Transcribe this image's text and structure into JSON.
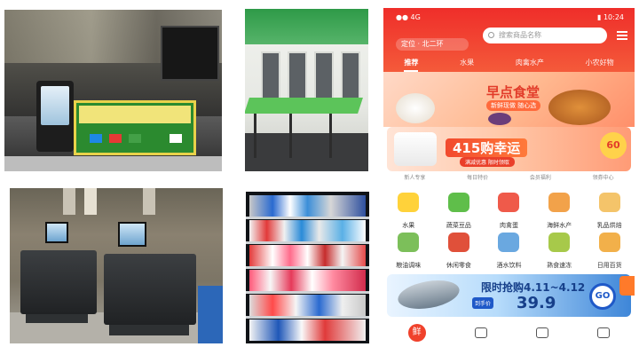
{
  "photos": {
    "checkout_counter": {
      "sign_colors": {
        "panel": "#2b8a2f",
        "border": "#e9d24a"
      }
    },
    "green_station": {
      "accent": "#5cc45a"
    },
    "app": {
      "status_left": "●● 4G",
      "status_right": "▮ 10:24",
      "location_label": "定位 · 北二环",
      "search_placeholder": "搜索商品名称",
      "tabs": [
        "推荐",
        "水果",
        "肉禽水产",
        "小农好物"
      ],
      "banner1_title": "早点食堂",
      "banner1_sub": "新鲜现做 随心选",
      "banner2_title": "415购幸运",
      "banner2_sub": "满减优惠 限时领取",
      "badge": "60",
      "hint_row": [
        "新人专享",
        "每日特价",
        "会员福利",
        "领券中心"
      ],
      "categories": [
        {
          "label": "水果",
          "color": "#ffd23a"
        },
        {
          "label": "蔬菜豆品",
          "color": "#5fbe4a"
        },
        {
          "label": "肉禽蛋",
          "color": "#ef5a4a"
        },
        {
          "label": "海鲜水产",
          "color": "#f2a24a"
        },
        {
          "label": "乳品烘焙",
          "color": "#f4c46a"
        },
        {
          "label": "粮油调味",
          "color": "#7cbf5a"
        },
        {
          "label": "休闲零食",
          "color": "#e0503a"
        },
        {
          "label": "酒水饮料",
          "color": "#6aa8e0"
        },
        {
          "label": "熟食速冻",
          "color": "#a7c94a"
        },
        {
          "label": "日用百货",
          "color": "#f2b04a"
        }
      ],
      "flash_title": "限时抢购4.11~4.12",
      "flash_tag": "到手价",
      "flash_price": "39.9",
      "go_label": "GO",
      "home_icon_text": "鲜",
      "accent": "#ef2e2a"
    }
  }
}
